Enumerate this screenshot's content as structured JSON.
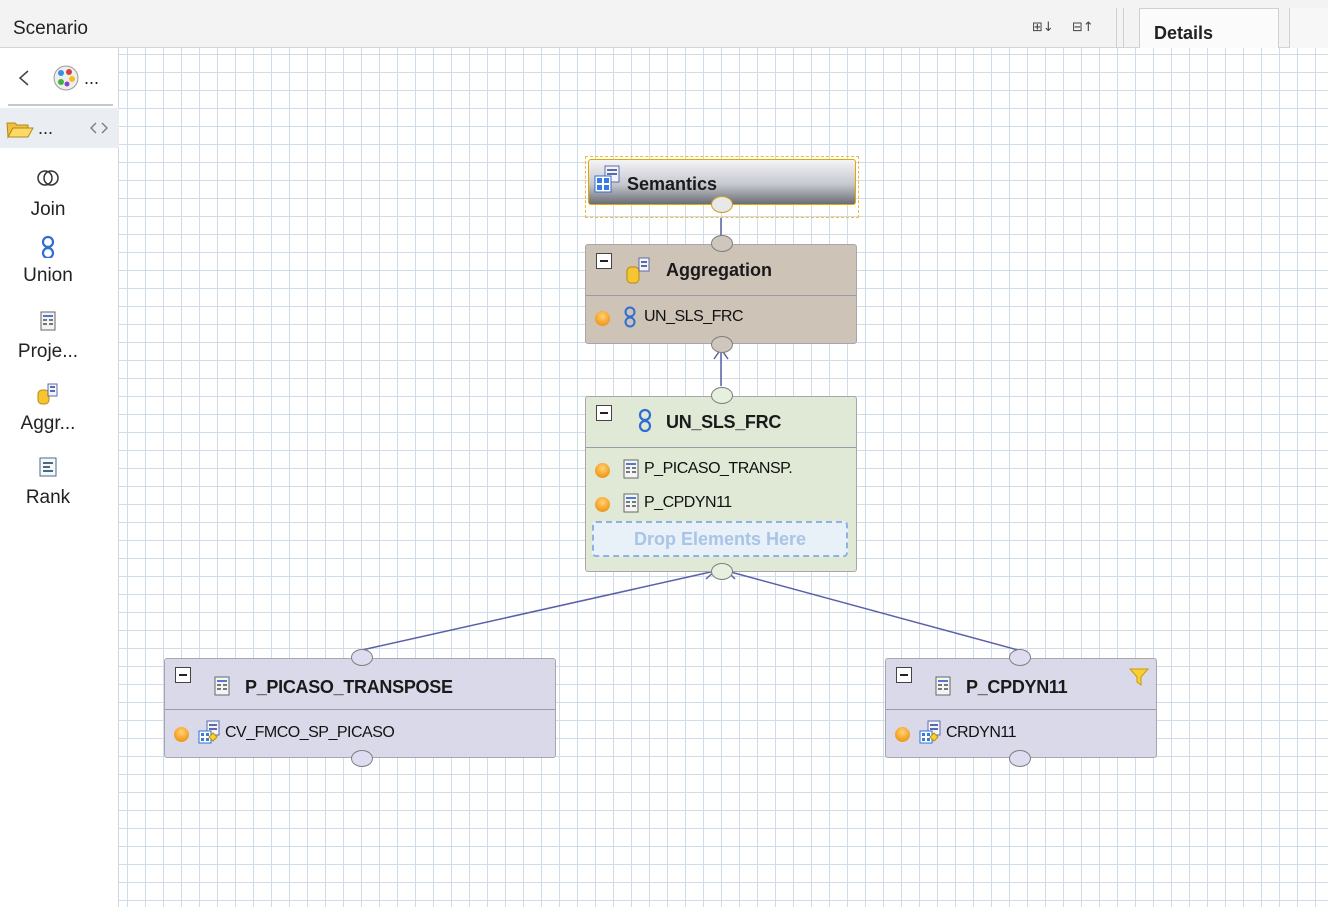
{
  "topbar": {
    "title": "Scenario",
    "expand_label": "⊞↓",
    "collapse_label": "⊟↑",
    "details_tab": "Details"
  },
  "palette": {
    "row1_more": "...",
    "row2_more": "...",
    "items": [
      {
        "label": "Join",
        "icon": "join-icon"
      },
      {
        "label": "Union",
        "icon": "union-icon"
      },
      {
        "label": "Proje...",
        "icon": "projection-icon"
      },
      {
        "label": "Aggr...",
        "icon": "aggregation-icon"
      },
      {
        "label": "Rank",
        "icon": "rank-icon"
      }
    ]
  },
  "nodes": {
    "semantics": {
      "title": "Semantics"
    },
    "aggregation": {
      "title": "Aggregation",
      "inputs": [
        "UN_SLS_FRC"
      ]
    },
    "union": {
      "title": "UN_SLS_FRC",
      "inputs": [
        "P_PICASO_TRANSP.",
        "P_CPDYN11"
      ],
      "drop_hint": "Drop Elements Here"
    },
    "projection_left": {
      "title": "P_PICASO_TRANSPOSE",
      "inputs": [
        "CV_FMCO_SP_PICASO"
      ]
    },
    "projection_right": {
      "title": "P_CPDYN11",
      "inputs": [
        "CRDYN11"
      ]
    }
  },
  "colors": {
    "aggregation_bg": "#cdc3b7",
    "union_bg": "#dfe9d6",
    "projection_bg": "#dad9ea",
    "connector": "#5b5fa8",
    "grid": "#cfdcea"
  }
}
